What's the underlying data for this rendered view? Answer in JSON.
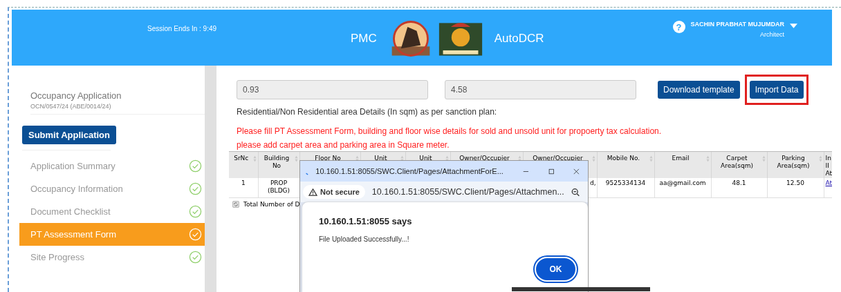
{
  "header": {
    "session": "Session Ends In : 9:49",
    "brand_left": "PMC",
    "brand_right": "AutoDCR",
    "help": "?",
    "user_name": "SACHIN PRABHAT MUJUMDAR",
    "user_role": "Architect"
  },
  "sidebar": {
    "title": "Occupancy Application",
    "subtitle": "OCN/0547/24  (ABE/0014/24)",
    "submit": "Submit Application",
    "items": [
      {
        "label": "Application Summary",
        "selected": false,
        "done": true
      },
      {
        "label": "Occupancy Information",
        "selected": false,
        "done": true
      },
      {
        "label": "Document Checklist",
        "selected": false,
        "done": true
      },
      {
        "label": "PT Assessment Form",
        "selected": true,
        "done": true
      },
      {
        "label": "Site Progress",
        "selected": false,
        "done": true
      }
    ]
  },
  "form": {
    "fields": [
      {
        "value": "0.93"
      },
      {
        "value": "4.58"
      }
    ],
    "buttons": [
      {
        "label": "Download template",
        "highlighted": false
      },
      {
        "label": "Import Data",
        "highlighted": true
      }
    ],
    "section_label": "Residential/Non Residential area Details (In sqm) as per sanction plan:",
    "warnings": [
      "Please fill PT Assessment Form, building and floor wise details for sold and unsold unit for propoerty tax calculation.",
      "please add carpet area and parking area in Square meter."
    ]
  },
  "table": {
    "columns": [
      "SrNc",
      "Building No",
      "Floor No",
      "Unit",
      "Unit",
      "Owner/Occupier",
      "Owner/Occupier",
      "Mobile No.",
      "Email",
      "Carpet Area(sqm)",
      "Parking Area(sqm)",
      "In II At"
    ],
    "rows": [
      {
        "cells": [
          "1",
          "PROP (BLDG)",
          null,
          null,
          null,
          null,
          "d,",
          "9525334134",
          "aa@gmail.com",
          "48.1",
          "12.50",
          "At"
        ]
      }
    ],
    "footer": "Total Number of D"
  },
  "dialog": {
    "tab_title": "10.160.1.51:8055/SWC.Client/Pages/AttachmentForE...",
    "security": "Not secure",
    "address": "10.160.1.51:8055/SWC.Client/Pages/Attachmen...",
    "heading": "10.160.1.51:8055 says",
    "message": "File Uploaded Successfully...!",
    "ok": "OK"
  }
}
